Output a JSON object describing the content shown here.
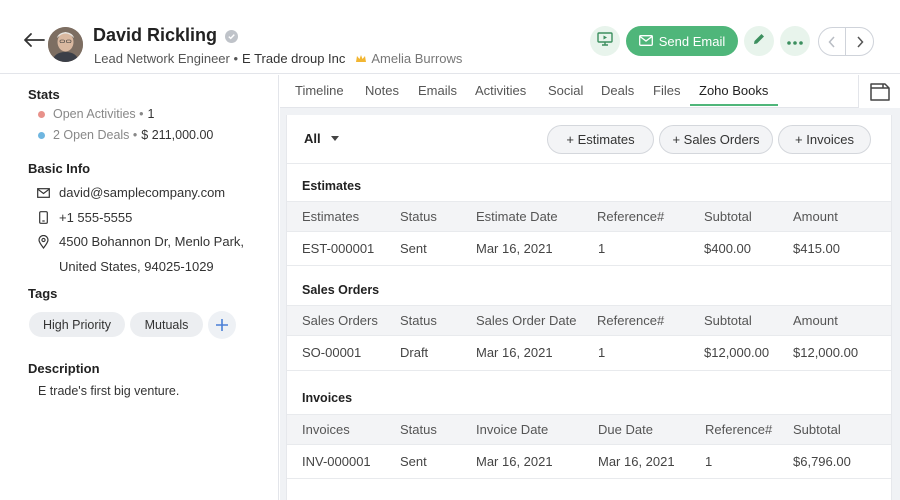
{
  "header": {
    "name": "David Rickling",
    "role": "Lead Network Engineer •",
    "company": "E Trade droup Inc",
    "owner": "Amelia Burrows",
    "send_email_label": "Send Email",
    "accent_color": "#4fb67a"
  },
  "stats": {
    "title": "Stats",
    "open_activities_label": "Open Activities •",
    "open_activities_count": "1",
    "open_deals_label": "2 Open Deals •",
    "open_deals_amount": "$ 211,000.00"
  },
  "basic_info": {
    "title": "Basic Info",
    "email": "david@samplecompany.com",
    "phone": "+1 555-5555",
    "address_line1": "4500 Bohannon Dr, Menlo Park,",
    "address_line2": "United States, 94025-1029"
  },
  "tags": {
    "title": "Tags",
    "items": [
      "High Priority",
      "Mutuals"
    ]
  },
  "description": {
    "title": "Description",
    "text": "E trade's first big venture."
  },
  "tabs": [
    "Timeline",
    "Notes",
    "Emails",
    "Activities",
    "Social",
    "Deals",
    "Files",
    "Zoho Books"
  ],
  "active_tab": "Zoho Books",
  "filter": {
    "selected": "All"
  },
  "actions": {
    "estimates": "+ Estimates",
    "sales_orders": "+ Sales Orders",
    "invoices": "+ Invoices"
  },
  "estimates": {
    "title": "Estimates",
    "headers": [
      "Estimates",
      "Status",
      "Estimate Date",
      "Reference#",
      "Subtotal",
      "Amount"
    ],
    "rows": [
      [
        "EST-000001",
        "Sent",
        "Mar 16, 2021",
        "1",
        "$400.00",
        "$415.00"
      ]
    ]
  },
  "sales_orders": {
    "title": "Sales Orders",
    "headers": [
      "Sales Orders",
      "Status",
      "Sales Order Date",
      "Reference#",
      "Subtotal",
      "Amount"
    ],
    "rows": [
      [
        "SO-00001",
        "Draft",
        "Mar 16, 2021",
        "1",
        "$12,000.00",
        "$12,000.00"
      ]
    ]
  },
  "invoices": {
    "title": "Invoices",
    "headers": [
      "Invoices",
      "Status",
      "Invoice Date",
      "Due Date",
      "Reference#",
      "Subtotal"
    ],
    "rows": [
      [
        "INV-000001",
        "Sent",
        "Mar 16, 2021",
        "Mar 16, 2021",
        "1",
        "$6,796.00"
      ]
    ]
  }
}
